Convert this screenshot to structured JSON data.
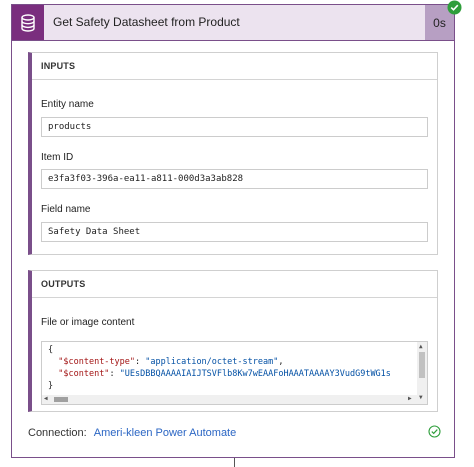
{
  "action": {
    "title": "Get Safety Datasheet from Product",
    "duration": "0s",
    "icon": "database-icon",
    "status_icon": "success-check-icon"
  },
  "inputs": {
    "section_title": "INPUTS",
    "entity_name_label": "Entity name",
    "entity_name_value": "products",
    "item_id_label": "Item ID",
    "item_id_value": "e3fa3f03-396a-ea11-a811-000d3a3ab828",
    "field_name_label": "Field name",
    "field_name_value": "Safety Data Sheet"
  },
  "outputs": {
    "section_title": "OUTPUTS",
    "content_label": "File or image content",
    "code_open": "{",
    "content_type_key": "\"$content-type\"",
    "content_type_value": "\"application/octet-stream\"",
    "content_key": "\"$content\"",
    "content_value": "\"UEsDBBQAAAAIAIJTSVFlb8Kw7wEAAFoHAAATAAAAY3VudG9tWG1s",
    "code_close": "}"
  },
  "connection": {
    "label": "Connection:",
    "name": "Ameri-kleen Power Automate",
    "status_icon": "success-circle-icon"
  },
  "colors": {
    "accent": "#7a2e7e",
    "header_bg": "#ece3ef",
    "success": "#2e9e3b",
    "link": "#2b66c4"
  }
}
